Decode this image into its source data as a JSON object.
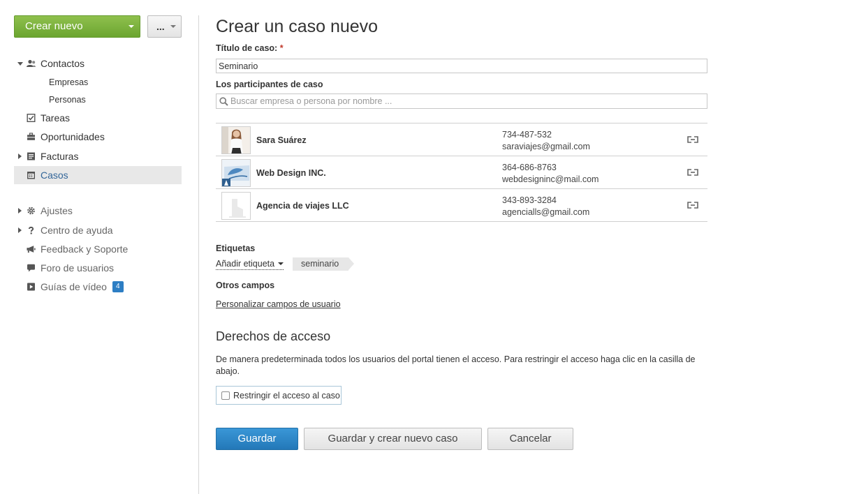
{
  "sidebar": {
    "create_label": "Crear nuevo",
    "more_label": "...",
    "nav": {
      "contacts": "Contactos",
      "companies": "Empresas",
      "persons": "Personas",
      "tasks": "Tareas",
      "opportunities": "Oportunidades",
      "invoices": "Facturas",
      "cases": "Casos",
      "settings": "Ajustes",
      "help": "Centro de ayuda",
      "feedback": "Feedback y Soporte",
      "forum": "Foro de usuarios",
      "videos": "Guías de vídeo",
      "videos_badge": "4"
    }
  },
  "form": {
    "page_title": "Crear un caso nuevo",
    "title_label": "Título de caso:",
    "required_mark": "*",
    "title_value": "Seminario",
    "participants_label": "Los participantes de caso",
    "search_placeholder": "Buscar empresa o persona por nombre ...",
    "participants": [
      {
        "name": "Sara Suárez",
        "phone": "734-487-532",
        "email": "saraviajes@gmail.com"
      },
      {
        "name": "Web Design INC.",
        "phone": "364-686-8763",
        "email": "webdesigninc@mail.com"
      },
      {
        "name": "Agencia de viajes LLC",
        "phone": "343-893-3284",
        "email": "agencialls@gmail.com"
      }
    ],
    "tags_label": "Etiquetas",
    "add_tag_label": "Añadir etiqueta",
    "tags": [
      "seminario"
    ],
    "other_fields_label": "Otros campos",
    "customize_link": "Personalizar campos de usuario",
    "access_title": "Derechos de acceso",
    "access_desc": "De manera predeterminada todos los usuarios del portal tienen el acceso. Para restringir el acceso haga clic en la casilla de abajo.",
    "restrict_label": "Restringir el acceso al caso",
    "restrict_checked": false,
    "save_label": "Guardar",
    "save_new_label": "Guardar y crear nuevo caso",
    "cancel_label": "Cancelar"
  },
  "colors": {
    "create_button": "#78b13b",
    "primary_button": "#2b84c6",
    "active_nav_bg": "#e8e8e8",
    "active_nav_text": "#336699",
    "badge": "#2d7ec4",
    "required": "#c0392b"
  }
}
